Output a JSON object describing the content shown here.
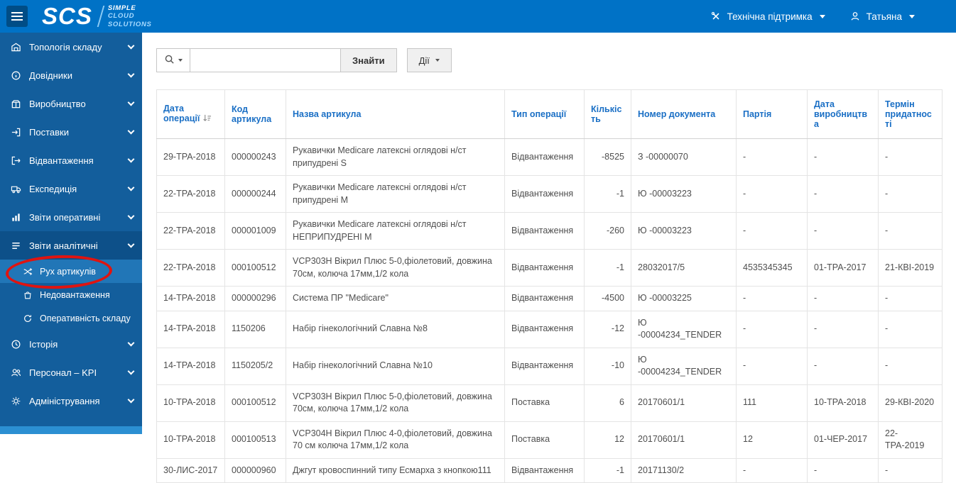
{
  "colors": {
    "topbar_blue": "#0072C6",
    "sidebar_blue": "#135E9C",
    "active_item_blue": "#2176B7",
    "header_text_blue": "#1A6FC5",
    "annotation_red": "#E01410"
  },
  "topbar": {
    "logo": {
      "scs": "SCS",
      "lines": [
        "SIMPLE",
        "CLOUD",
        "SOLUTIONS"
      ]
    },
    "support": {
      "label": "Технічна підтримка"
    },
    "user": {
      "label": "Татьяна"
    }
  },
  "sidebar": {
    "items": [
      {
        "label": "Топологія складу",
        "icon": "warehouse-icon"
      },
      {
        "label": "Довідники",
        "icon": "info-icon"
      },
      {
        "label": "Виробництво",
        "icon": "production-icon"
      },
      {
        "label": "Поставки",
        "icon": "supplies-icon"
      },
      {
        "label": "Відвантаження",
        "icon": "shipping-icon"
      },
      {
        "label": "Експедиція",
        "icon": "truck-icon"
      },
      {
        "label": "Звіти оперативні",
        "icon": "bar-chart-icon"
      },
      {
        "label": "Звіти аналітичні",
        "icon": "lines-icon",
        "expanded": true,
        "children": [
          {
            "label": "Рух артикулів",
            "icon": "shuffle-icon",
            "active": true
          },
          {
            "label": "Недовантаження",
            "icon": "bag-icon"
          },
          {
            "label": "Оперативність складу",
            "icon": "cycle-icon"
          }
        ]
      },
      {
        "label": "Історія",
        "icon": "history-icon"
      },
      {
        "label": "Персонал – KPI",
        "icon": "people-icon"
      },
      {
        "label": "Адміністрування",
        "icon": "admin-icon"
      }
    ]
  },
  "toolbar": {
    "search_value": "",
    "search_button_label": "Знайти",
    "actions_label": "Дії"
  },
  "table": {
    "sorted_by": {
      "column": "Дата операції",
      "direction": "desc"
    },
    "columns": [
      "Дата операції",
      "Код артикула",
      "Назва артикула",
      "Тип операції",
      "Кількість",
      "Номер документа",
      "Партія",
      "Дата виробництва",
      "Термін придатності"
    ],
    "column_keys": [
      "operation-date",
      "article-code",
      "article-name",
      "operation-type",
      "quantity",
      "document-number",
      "batch",
      "production-date",
      "expiry-date"
    ],
    "rows": [
      [
        "29-ТРА-2018",
        "000000243",
        "Рукавички Medicare латексні оглядові н/ст припудрені S",
        "Відвантаження",
        "-8525",
        "З -00000070",
        "-",
        "-",
        "-"
      ],
      [
        "22-ТРА-2018",
        "000000244",
        "Рукавички Medicare латексні оглядові н/ст припудрені М",
        "Відвантаження",
        "-1",
        "Ю -00003223",
        "-",
        "-",
        "-"
      ],
      [
        "22-ТРА-2018",
        "000001009",
        "Рукавички Medicare латексні оглядові н/ст НЕПРИПУДРЕНІ М",
        "Відвантаження",
        "-260",
        "Ю -00003223",
        "-",
        "-",
        "-"
      ],
      [
        "22-ТРА-2018",
        "000100512",
        "VCP303H Вікрил Плюс 5-0,фіолетовий, довжина 70см, колюча 17мм,1/2 кола",
        "Відвантаження",
        "-1",
        "28032017/5",
        "4535345345",
        "01-ТРА-2017",
        "21-КВІ-2019"
      ],
      [
        "14-ТРА-2018",
        "000000296",
        "Система ПР \"Medicare\"",
        "Відвантаження",
        "-4500",
        "Ю -00003225",
        "-",
        "-",
        "-"
      ],
      [
        "14-ТРА-2018",
        "1150206",
        "Набір гінекологічний Славна №8",
        "Відвантаження",
        "-12",
        "Ю -00004234_TENDER",
        "-",
        "-",
        "-"
      ],
      [
        "14-ТРА-2018",
        "1150205/2",
        "Набір гінекологічний Славна №10",
        "Відвантаження",
        "-10",
        "Ю -00004234_TENDER",
        "-",
        "-",
        "-"
      ],
      [
        "10-ТРА-2018",
        "000100512",
        "VCP303H Вікрил Плюс 5-0,фіолетовий, довжина 70см, колюча 17мм,1/2 кола",
        "Поставка",
        "6",
        "20170601/1",
        "111",
        "10-ТРА-2018",
        "29-КВІ-2020"
      ],
      [
        "10-ТРА-2018",
        "000100513",
        "VCP304H Вікрил Плюс 4-0,фіолетовий, довжина 70 см колюча 17мм,1/2 кола",
        "Поставка",
        "12",
        "20170601/1",
        "12",
        "01-ЧЕР-2017",
        "22-ТРА-2019"
      ],
      [
        "30-ЛИС-2017",
        "000000960",
        "Джгут кровоспинний типу Есмарха з кнопкою111",
        "Відвантаження",
        "-1",
        "20171130/2",
        "-",
        "-",
        "-"
      ]
    ]
  }
}
